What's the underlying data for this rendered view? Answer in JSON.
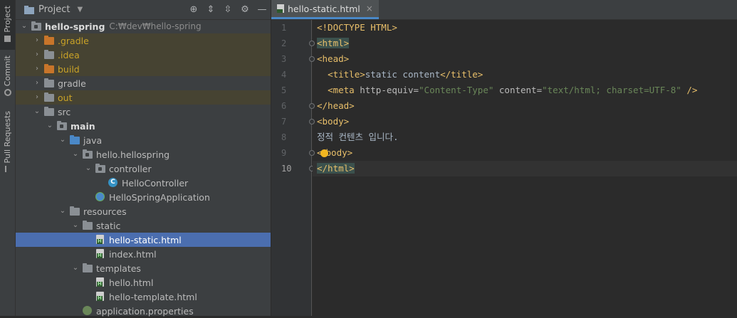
{
  "toolstrip": {
    "tabs": [
      {
        "label": "Project"
      },
      {
        "label": "Commit"
      },
      {
        "label": "Pull Requests"
      }
    ]
  },
  "project_panel": {
    "title": "Project",
    "tree": [
      {
        "name": "hello-spring",
        "path": "C:₩dev₩hello-spring"
      },
      {
        "name": ".gradle"
      },
      {
        "name": ".idea"
      },
      {
        "name": "build"
      },
      {
        "name": "gradle"
      },
      {
        "name": "out"
      },
      {
        "name": "src"
      },
      {
        "name": "main"
      },
      {
        "name": "java"
      },
      {
        "name": "hello.hellospring"
      },
      {
        "name": "controller"
      },
      {
        "name": "HelloController"
      },
      {
        "name": "HelloSpringApplication"
      },
      {
        "name": "resources"
      },
      {
        "name": "static"
      },
      {
        "name": "hello-static.html"
      },
      {
        "name": "index.html"
      },
      {
        "name": "templates"
      },
      {
        "name": "hello.html"
      },
      {
        "name": "hello-template.html"
      },
      {
        "name": "application.properties"
      }
    ]
  },
  "editor": {
    "tab_label": "hello-static.html",
    "line_numbers": [
      "1",
      "2",
      "3",
      "4",
      "5",
      "6",
      "7",
      "8",
      "9",
      "10"
    ],
    "code": {
      "l1": "<!DOCTYPE HTML>",
      "l2_tag": "<html>",
      "l3_tag": "<head>",
      "l4_indent": "  ",
      "l4_open": "<title>",
      "l4_text": "static content",
      "l4_close": "</title>",
      "l5_indent": "  ",
      "l5_open": "<meta ",
      "l5_attr1": "http-equiv=",
      "l5_val1": "\"Content-Type\"",
      "l5_sp": " ",
      "l5_attr2": "content=",
      "l5_val2": "\"text/html; charset=UTF-8\"",
      "l5_end": " />",
      "l6_tag": "</head>",
      "l7_tag": "<body>",
      "l8_text": "정적 컨텐츠 입니다.",
      "l9_a": "<",
      "l9_b": "body>",
      "l10_tag": "</html>"
    }
  },
  "colors": {
    "selection": "#4b6eaf",
    "tag": "#e8bf6a",
    "string": "#6a8759",
    "excluded_folder": "#c8752a"
  }
}
